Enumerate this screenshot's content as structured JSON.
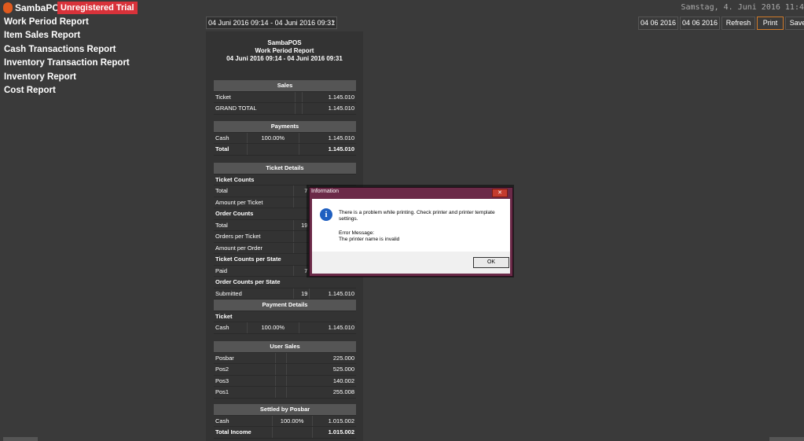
{
  "app": {
    "logo_text": "SambaPOS",
    "trial_badge": "Unregistered Trial",
    "clock": "Samstag, 4. Juni 2016 11:4"
  },
  "sidebar": {
    "items": [
      {
        "label": "Work Period Report"
      },
      {
        "label": "Item Sales Report"
      },
      {
        "label": "Cash Transactions Report"
      },
      {
        "label": "Inventory Transaction Report"
      },
      {
        "label": "Inventory Report"
      },
      {
        "label": "Cost Report"
      }
    ]
  },
  "toolbar": {
    "date_range": "04 Juni 2016 09:14 - 04 Juni 2016 09:31",
    "date_from": "04 06 2016",
    "date_to": "04 06 2016",
    "refresh_label": "Refresh",
    "print_label": "Print",
    "save_label": "Save"
  },
  "report": {
    "company": "SambaPOS",
    "title": "Work Period Report",
    "period": "04 Juni 2016 09:14 - 04 Juni 2016 09:31",
    "sales": {
      "header": "Sales",
      "rows": [
        {
          "label": "Ticket",
          "value": "1.145.010"
        },
        {
          "label": "GRAND TOTAL",
          "value": "1.145.010"
        }
      ]
    },
    "payments": {
      "header": "Payments",
      "rows": [
        {
          "label": "Cash",
          "pct": "100.00%",
          "value": "1.145.010"
        },
        {
          "label": "Total",
          "value": "1.145.010"
        }
      ]
    },
    "ticket_details": {
      "header": "Ticket Details",
      "ticket_counts": "Ticket Counts",
      "total_label": "Total",
      "total_count": "7",
      "amount_per_ticket": "Amount per Ticket",
      "order_counts": "Order Counts",
      "order_total_label": "Total",
      "order_total_count": "19",
      "orders_per_ticket": "Orders per Ticket",
      "amount_per_order": "Amount per Order",
      "ticket_counts_per_state": "Ticket Counts per State",
      "paid_label": "Paid",
      "paid_count": "7",
      "order_counts_per_state": "Order Counts per State",
      "submitted_label": "Submitted",
      "submitted_count": "19",
      "submitted_value": "1.145.010"
    },
    "payment_details": {
      "header": "Payment Details",
      "sub": "Ticket",
      "row": {
        "label": "Cash",
        "pct": "100.00%",
        "value": "1.145.010"
      }
    },
    "user_sales": {
      "header": "User Sales",
      "rows": [
        {
          "label": "Posbar",
          "value": "225.000"
        },
        {
          "label": "Pos2",
          "value": "525.000"
        },
        {
          "label": "Pos3",
          "value": "140.002"
        },
        {
          "label": "Pos1",
          "value": "255.008"
        }
      ]
    },
    "settled": {
      "header": "Settled by Posbar",
      "cash_label": "Cash",
      "cash_pct": "100.00%",
      "cash_value": "1.015.002",
      "total_label": "Total Income",
      "total_value": "1.015.002"
    }
  },
  "dialog": {
    "title": "Information",
    "close": "✕",
    "message": "There is a problem while printing. Check printer and printer template settings.",
    "error_label": "Error Message:",
    "error_text": "The printer name is invalid",
    "ok_label": "OK",
    "icon": "info-icon"
  }
}
